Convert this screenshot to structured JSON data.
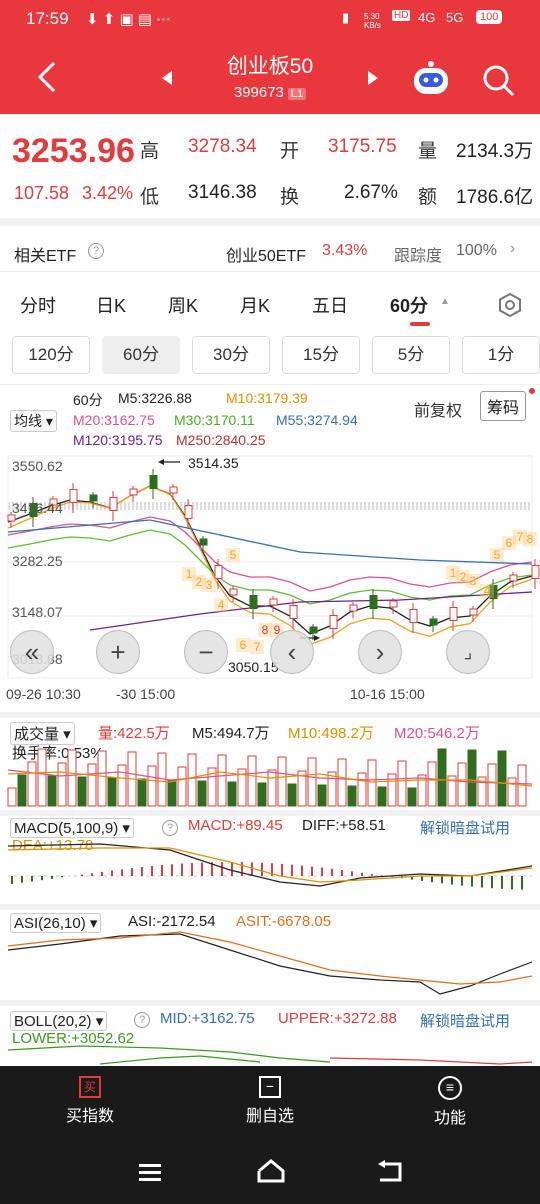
{
  "status": {
    "time": "17:59",
    "speed": "5.30 KB/s",
    "net1": "4G",
    "net2": "5G",
    "battery": "100"
  },
  "header": {
    "title": "创业板50",
    "code": "399673",
    "level": "L1"
  },
  "quote": {
    "price": "3253.96",
    "change": "107.58",
    "pct": "3.42%",
    "high_label": "高",
    "high": "3278.34",
    "open_label": "开",
    "open": "3175.75",
    "vol_label": "量",
    "vol": "2134.3万",
    "low_label": "低",
    "low": "3146.38",
    "turn_label": "换",
    "turn": "2.67%",
    "amt_label": "额",
    "amt": "1786.6亿"
  },
  "etf": {
    "label": "相关ETF",
    "name": "创业50ETF",
    "pct": "3.43%",
    "track_label": "跟踪度",
    "track": "100%"
  },
  "tabs": [
    "分时",
    "日K",
    "周K",
    "月K",
    "五日",
    "60分"
  ],
  "chips": [
    "120分",
    "60分",
    "30分",
    "15分",
    "5分",
    "1分"
  ],
  "ma": {
    "btn": "均线",
    "period": "60分",
    "m5": "M5:3226.88",
    "m10": "M10:3179.39",
    "m20": "M20:3162.75",
    "m30": "M30:3170.11",
    "m55": "M55:3274.94",
    "m120": "M120:3195.75",
    "m250": "M250:2840.25",
    "fq": "前复权",
    "chip_btn": "筹码"
  },
  "axis": {
    "y1": "3550.62",
    "y2": "3416.44",
    "y3": "3282.25",
    "y4": "3148.07",
    "y5": "3013.88",
    "x1": "09-26 10:30",
    "x2": "-30 15:00",
    "x3": "10-16 15:00",
    "hi": "3514.35",
    "lo": "3050.15"
  },
  "vol": {
    "btn": "成交量",
    "v": "量:422.5万",
    "m5": "M5:494.7万",
    "m10": "M10:498.2万",
    "m20": "M20:546.2万",
    "turn": "换手率:0.53%"
  },
  "macd": {
    "btn": "MACD(5,100,9)",
    "macd": "MACD:+89.45",
    "diff": "DIFF:+58.51",
    "dea": "DEA:+13.78",
    "unlock": "解锁暗盘试用"
  },
  "asi": {
    "btn": "ASI(26,10)",
    "asi": "ASI:-2172.54",
    "asit": "ASIT:-6678.05"
  },
  "boll": {
    "btn": "BOLL(20,2)",
    "mid": "MID:+3162.75",
    "upper": "UPPER:+3272.88",
    "lower": "LOWER:+3052.62",
    "unlock": "解锁暗盘试用"
  },
  "bottom": {
    "buy_icon": "买",
    "buy": "买指数",
    "del": "删自选",
    "func": "功能"
  },
  "colors": {
    "up": "#e23b3b",
    "down": "#2f6e1e",
    "header": "#e8383d",
    "m5": "#222222",
    "m10": "#f0a020",
    "m20": "#e0508a",
    "m30": "#5cc030",
    "m55": "#3570b0",
    "m120": "#6a2090",
    "m250": "#b83030"
  }
}
